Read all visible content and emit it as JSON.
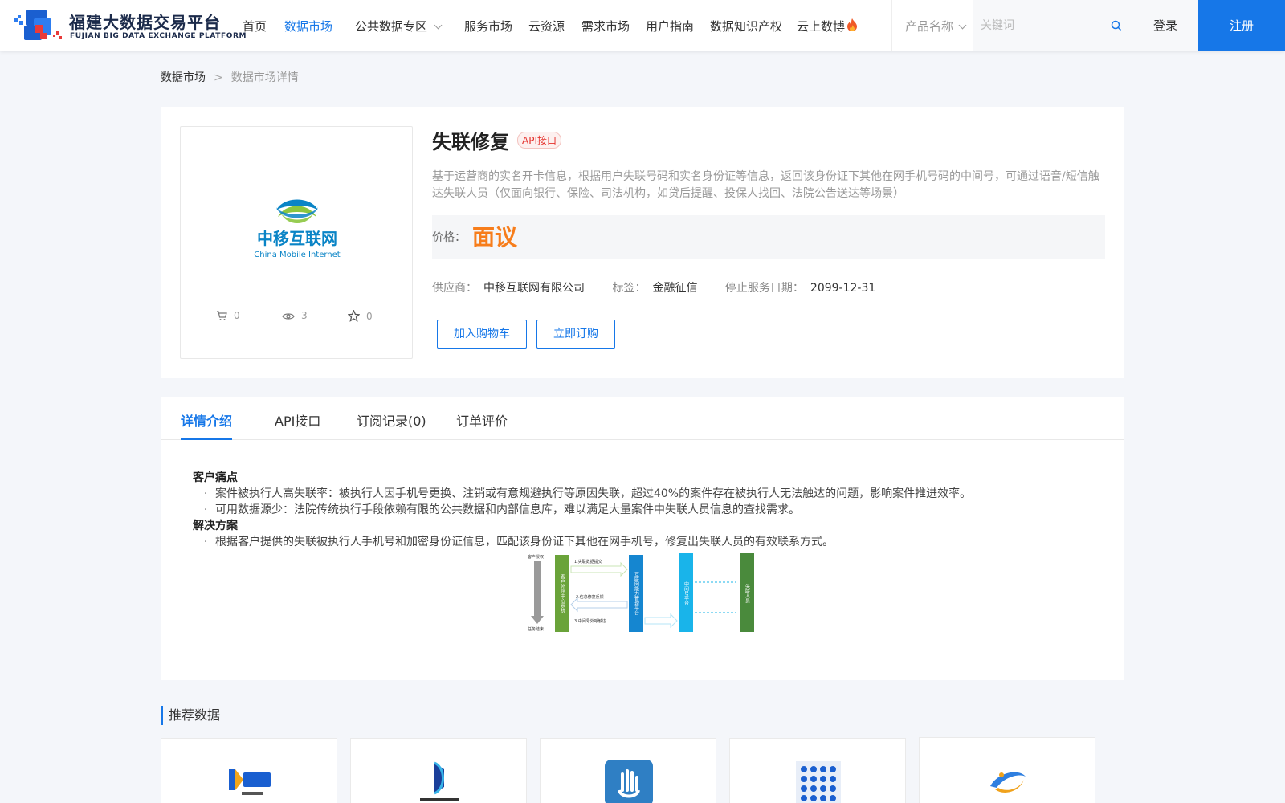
{
  "header": {
    "logo_cn": "福建大数据交易平台",
    "logo_en": "FUJIAN BIG DATA EXCHANGE PLATFORM",
    "nav": [
      {
        "label": "首页"
      },
      {
        "label": "数据市场",
        "active": true
      },
      {
        "label": "公共数据专区"
      },
      {
        "label": "服务市场"
      },
      {
        "label": "云资源"
      },
      {
        "label": "需求市场"
      },
      {
        "label": "用户指南"
      },
      {
        "label": "数据知识产权"
      },
      {
        "label": "云上数博"
      }
    ],
    "search_category": "产品名称",
    "search_placeholder": "关键词",
    "login": "登录",
    "register": "注册",
    "accent_color": "#1677e8"
  },
  "breadcrumb": {
    "root": "数据市场",
    "separator": ">",
    "current": "数据市场详情"
  },
  "product": {
    "image_text_cn": "中移互联网",
    "image_text_en": "China Mobile Internet",
    "stats": {
      "cart": "0",
      "views": "3",
      "favorites": "0"
    },
    "title": "失联修复",
    "badge": "API接口",
    "description": "基于运营商的实名开卡信息，根据用户失联号码和实名身份证等信息，返回该身份证下其他在网手机号码的中间号，可通过语音/短信触达失联人员（仅面向银行、保险、司法机构，如贷后提醒、投保人找回、法院公告送达等场景）",
    "price_label": "价格：",
    "price_value": "面议",
    "supplier_label": "供应商：",
    "supplier": "中移互联网有限公司",
    "tag_label": "标签：",
    "tag": "金融征信",
    "stop_label": "停止服务日期：",
    "stop_date": "2099-12-31",
    "add_cart": "加入购物车",
    "subscribe": "立即订购"
  },
  "tabs": [
    {
      "label": "详情介绍",
      "active": true
    },
    {
      "label": "API接口"
    },
    {
      "label": "订阅记录(0)"
    },
    {
      "label": "订单评价"
    }
  ],
  "detail": {
    "pain_title": "客户痛点",
    "pain_1": "案件被执行人高失联率：被执行人因手机号更换、注销或有意规避执行等原因失联，超过40%的案件存在被执行人无法触达的问题，影响案件推进效率。",
    "pain_2": "可用数据源少：法院传统执行手段依赖有限的公共数据和内部信息库，难以满足大量案件中失联人员信息的查找需求。",
    "solution_title": "解决方案",
    "solution_1": "根据客户提供的失联被执行人手机号和加密身份证信息，匹配该身份证下其他在网手机号，修复出失联人员的有效联系方式。",
    "diagram": {
      "left_top": "客户授权",
      "left_bottom": "任务结束",
      "col1": "客户外呼中心系统",
      "col2": "互联网能力管理平台",
      "col3": "中间号平台",
      "col4": "失联人员",
      "step1": "1.失联数据提交",
      "step2": "2.信息修复反馈",
      "step3": "3.中间号外呼触达"
    }
  },
  "recommend": {
    "title": "推荐数据"
  }
}
